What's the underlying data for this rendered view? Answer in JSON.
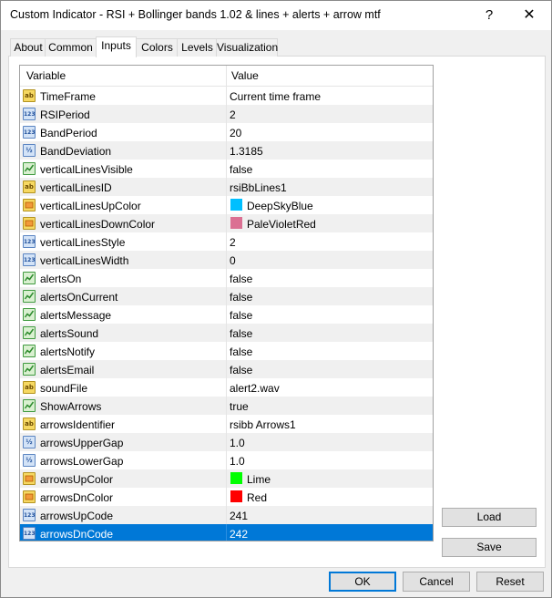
{
  "window": {
    "title": "Custom Indicator - RSI + Bollinger bands 1.02 & lines + alerts + arrow mtf",
    "help": "?",
    "close": "✕"
  },
  "tabs": [
    "About",
    "Common",
    "Inputs",
    "Colors",
    "Levels",
    "Visualization"
  ],
  "active_tab": "Inputs",
  "table": {
    "headers": {
      "variable": "Variable",
      "value": "Value"
    },
    "rows": [
      {
        "icon": "string-icon",
        "name": "TimeFrame",
        "value": "Current time frame"
      },
      {
        "icon": "integer-icon",
        "name": "RSIPeriod",
        "value": "2"
      },
      {
        "icon": "integer-icon",
        "name": "BandPeriod",
        "value": "20"
      },
      {
        "icon": "double-icon",
        "name": "BandDeviation",
        "value": "1.3185"
      },
      {
        "icon": "bool-icon",
        "name": "verticalLinesVisible",
        "value": "false"
      },
      {
        "icon": "string-icon",
        "name": "verticalLinesID",
        "value": "rsiBbLines1"
      },
      {
        "icon": "color-icon",
        "name": "verticalLinesUpColor",
        "value": "DeepSkyBlue",
        "swatch": "#00bfff"
      },
      {
        "icon": "color-icon",
        "name": "verticalLinesDownColor",
        "value": "PaleVioletRed",
        "swatch": "#db7093"
      },
      {
        "icon": "integer-icon",
        "name": "verticalLinesStyle",
        "value": "2"
      },
      {
        "icon": "integer-icon",
        "name": "verticalLinesWidth",
        "value": "0"
      },
      {
        "icon": "bool-icon",
        "name": "alertsOn",
        "value": "false"
      },
      {
        "icon": "bool-icon",
        "name": "alertsOnCurrent",
        "value": "false"
      },
      {
        "icon": "bool-icon",
        "name": "alertsMessage",
        "value": "false"
      },
      {
        "icon": "bool-icon",
        "name": "alertsSound",
        "value": "false"
      },
      {
        "icon": "bool-icon",
        "name": "alertsNotify",
        "value": "false"
      },
      {
        "icon": "bool-icon",
        "name": "alertsEmail",
        "value": "false"
      },
      {
        "icon": "string-icon",
        "name": "soundFile",
        "value": "alert2.wav"
      },
      {
        "icon": "bool-icon",
        "name": "ShowArrows",
        "value": "true"
      },
      {
        "icon": "string-icon",
        "name": "arrowsIdentifier",
        "value": "rsibb Arrows1"
      },
      {
        "icon": "double-icon",
        "name": "arrowsUpperGap",
        "value": "1.0"
      },
      {
        "icon": "double-icon",
        "name": "arrowsLowerGap",
        "value": "1.0"
      },
      {
        "icon": "color-icon",
        "name": "arrowsUpColor",
        "value": "Lime",
        "swatch": "#00ff00"
      },
      {
        "icon": "color-icon",
        "name": "arrowsDnColor",
        "value": "Red",
        "swatch": "#ff0000"
      },
      {
        "icon": "integer-icon",
        "name": "arrowsUpCode",
        "value": "241"
      },
      {
        "icon": "integer-icon",
        "name": "arrowsDnCode",
        "value": "242",
        "selected": true
      }
    ]
  },
  "buttons": {
    "load": "Load",
    "save": "Save",
    "ok": "OK",
    "cancel": "Cancel",
    "reset": "Reset"
  }
}
